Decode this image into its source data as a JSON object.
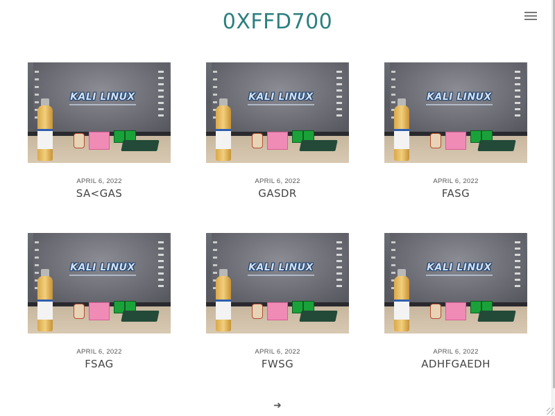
{
  "site": {
    "title": "0XFFD700"
  },
  "thumbnail_text": "KALI LINUX",
  "posts": [
    {
      "date": "APRIL 6, 2022",
      "title": "SA<GAS"
    },
    {
      "date": "APRIL 6, 2022",
      "title": "GASDR"
    },
    {
      "date": "APRIL 6, 2022",
      "title": "FASG"
    },
    {
      "date": "APRIL 6, 2022",
      "title": "FSAG"
    },
    {
      "date": "APRIL 6, 2022",
      "title": "FWSG"
    },
    {
      "date": "APRIL 6, 2022",
      "title": "ADHFGAEDH"
    }
  ],
  "pagination": {
    "next_icon": "arrow-right-icon",
    "next_glyph": "➜"
  },
  "colors": {
    "title": "#2c7f7f",
    "text": "#444444"
  }
}
